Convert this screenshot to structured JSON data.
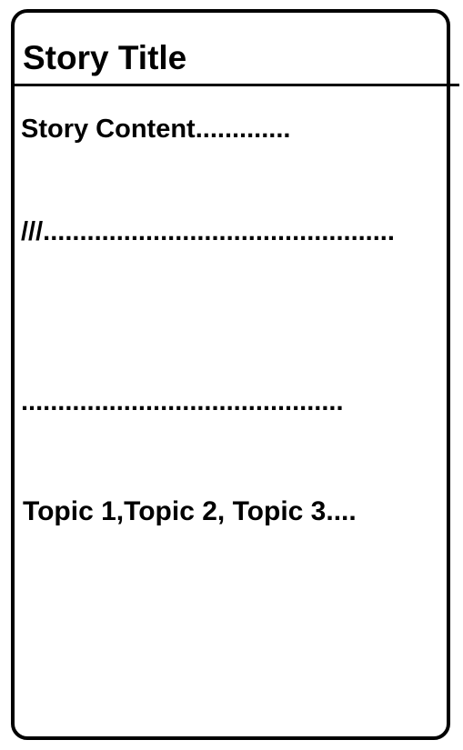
{
  "story": {
    "title": "Story Title",
    "content_lines": [
      "Story Content.............",
      "///................................................",
      "............................................"
    ],
    "topics": "Topic 1,Topic 2, Topic 3...."
  }
}
